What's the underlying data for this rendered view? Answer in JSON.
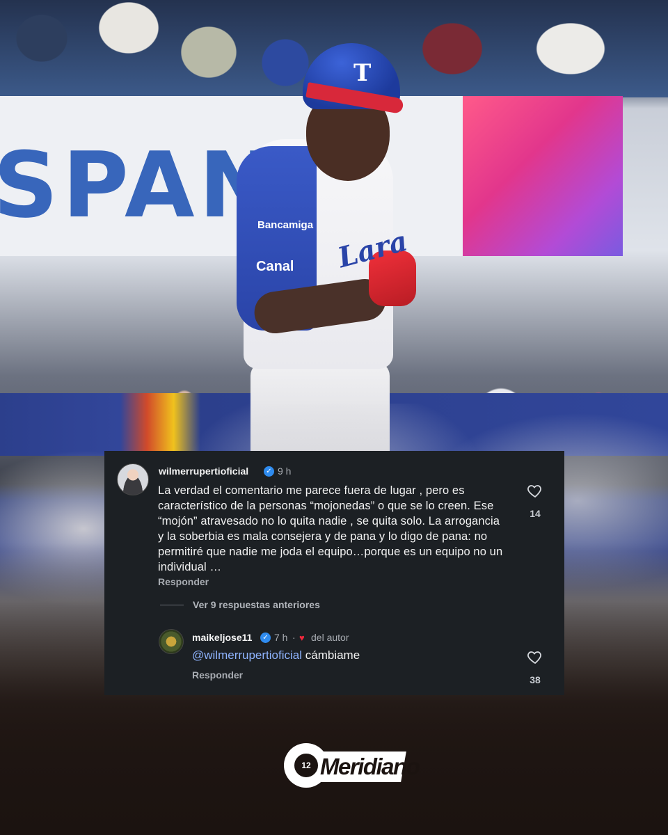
{
  "background": {
    "banner_text": "SPAN",
    "helmet_letter": "T",
    "jersey": {
      "sponsor1": "Bancamiga",
      "sponsor2": "Canal",
      "logo": "Lara"
    }
  },
  "comment": {
    "username": "wilmerrupertioficial",
    "time": "9 h",
    "text": "La verdad el comentario me parece fuera de lugar , pero es característico de la personas “mojonedas” o que se lo creen. Ese “mojón” atravesado no lo quita nadie , se quita solo. La arrogancia y la soberbia es mala consejera y de pana y lo digo de pana: no permitiré que nadie me joda el equipo…porque es un equipo no un individual …",
    "reply_label": "Responder",
    "likes": "14",
    "view_replies": "Ver 9 respuestas anteriores"
  },
  "reply": {
    "username": "maikeljose11",
    "time": "7 h",
    "separator": "·",
    "author_badge": "del autor",
    "mention": "@wilmerrupertioficial",
    "text": "cámbiame",
    "reply_label": "Responder",
    "likes": "38"
  },
  "logo": {
    "text": "Meridiano",
    "badge": "12"
  },
  "colors": {
    "card_bg": "#1c2024",
    "verified": "#2f8cf0",
    "mention": "#8fb4ff",
    "heart": "#f0283c"
  },
  "icons": {
    "verified": "verified-badge-icon",
    "like": "heart-outline-icon",
    "author_heart": "heart-filled-icon"
  }
}
